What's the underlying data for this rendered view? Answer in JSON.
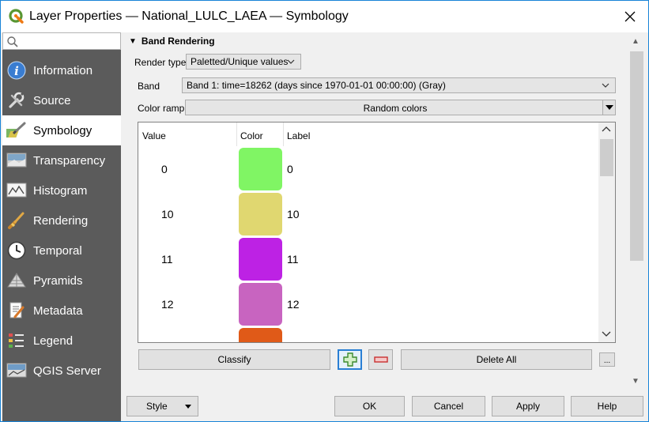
{
  "window": {
    "title": "Layer Properties — National_LULC_LAEA — Symbology"
  },
  "search": {
    "placeholder": "",
    "value": ""
  },
  "sidebar": {
    "items": [
      {
        "label": "Information",
        "icon": "info-icon"
      },
      {
        "label": "Source",
        "icon": "wrench-icon"
      },
      {
        "label": "Symbology",
        "icon": "paintbrush-icon",
        "active": true
      },
      {
        "label": "Transparency",
        "icon": "transparency-icon"
      },
      {
        "label": "Histogram",
        "icon": "histogram-icon"
      },
      {
        "label": "Rendering",
        "icon": "brush-icon"
      },
      {
        "label": "Temporal",
        "icon": "clock-icon"
      },
      {
        "label": "Pyramids",
        "icon": "pyramid-icon"
      },
      {
        "label": "Metadata",
        "icon": "metadata-icon"
      },
      {
        "label": "Legend",
        "icon": "legend-icon"
      },
      {
        "label": "QGIS Server",
        "icon": "server-icon"
      }
    ]
  },
  "band_rendering": {
    "section_title": "Band Rendering",
    "render_type_label": "Render type",
    "render_type_value": "Paletted/Unique values",
    "band_label": "Band",
    "band_value": "Band 1: time=18262 (days since 1970-01-01 00:00:00) (Gray)",
    "color_ramp_label": "Color ramp",
    "color_ramp_value": "Random colors"
  },
  "table": {
    "headers": {
      "value": "Value",
      "color": "Color",
      "label": "Label"
    },
    "rows": [
      {
        "value": "0",
        "color": "#80f564",
        "label": "0"
      },
      {
        "value": "10",
        "color": "#e0d770",
        "label": "10"
      },
      {
        "value": "11",
        "color": "#bd22e4",
        "label": "11"
      },
      {
        "value": "12",
        "color": "#c864c0",
        "label": "12"
      },
      {
        "value": "",
        "color": "#e05a18",
        "label": ""
      }
    ]
  },
  "actions": {
    "classify": "Classify",
    "delete_all": "Delete All",
    "more": "..."
  },
  "footer": {
    "style": "Style",
    "ok": "OK",
    "cancel": "Cancel",
    "apply": "Apply",
    "help": "Help"
  },
  "colors": {
    "sidebar_bg": "#5b5b5b",
    "accent_border": "#1883d7",
    "add_button_border": "#2a7fd4"
  }
}
